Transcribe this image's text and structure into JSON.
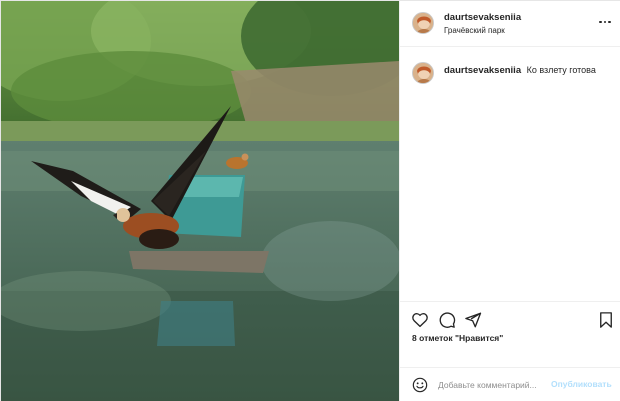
{
  "post": {
    "author": {
      "username": "daurtsevakseniia",
      "location": "Грачёвский парк"
    },
    "caption": {
      "username": "daurtsevakseniia",
      "text": "Ко взлету готова"
    },
    "likes_text": "8 отметок \"Нравится\"",
    "add_comment": {
      "placeholder": "Добавьте комментарий...",
      "publish_label": "Опубликовать"
    },
    "icons": {
      "more": "more-options-icon",
      "like": "heart-icon",
      "comment": "speech-bubble-icon",
      "share": "paper-plane-icon",
      "save": "bookmark-icon",
      "emoji": "smiley-icon"
    },
    "colors": {
      "publish_disabled": "#b2dffc",
      "text": "#262626",
      "secondary_text": "#8e8e8e"
    }
  }
}
